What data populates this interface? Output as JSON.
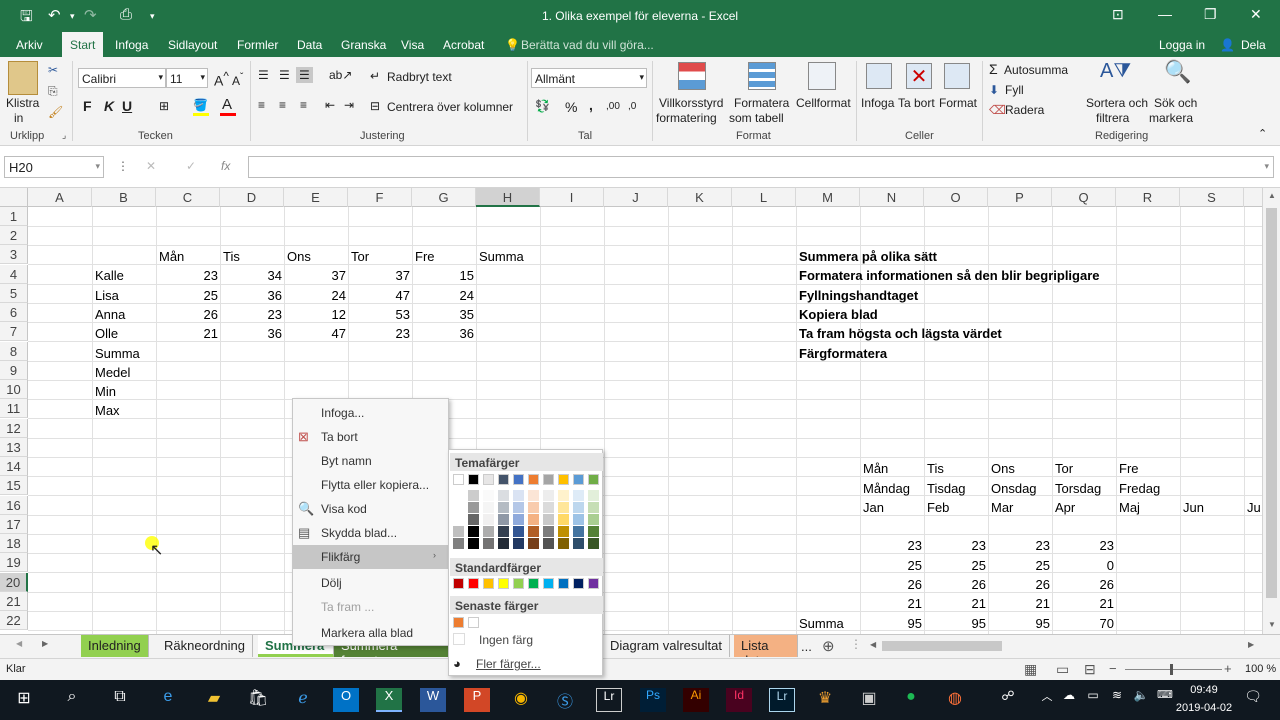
{
  "window": {
    "title": "1. Olika exempel för eleverna  -  Excel"
  },
  "ribbon_tabs": [
    "Arkiv",
    "Start",
    "Infoga",
    "Sidlayout",
    "Formler",
    "Data",
    "Granska",
    "Visa",
    "Acrobat"
  ],
  "tell_me": "Berätta vad du vill göra...",
  "account": {
    "login": "Logga in",
    "share": "Dela"
  },
  "clipboard": {
    "paste": "Klistra",
    "paste2": "in",
    "label": "Urklipp"
  },
  "font": {
    "name": "Calibri",
    "size": "11",
    "label": "Tecken",
    "bold": "F",
    "italic": "K",
    "underline": "U"
  },
  "alignment": {
    "wrap": "Radbryt text",
    "merge": "Centrera över kolumner",
    "label": "Justering"
  },
  "number": {
    "format": "Allmänt",
    "percent": "%",
    "comma": ",",
    "label": "Tal"
  },
  "styles": {
    "cond1": "Villkorsstyrd",
    "cond2": "formatering",
    "table1": "Formatera",
    "table2": "som tabell",
    "cell": "Cellformat",
    "label": "Format"
  },
  "cells": {
    "insert": "Infoga",
    "delete": "Ta bort",
    "format": "Format",
    "label": "Celler"
  },
  "editing": {
    "autosum": "Autosumma",
    "fill": "Fyll",
    "clear": "Radera",
    "sort1": "Sortera och",
    "sort2": "filtrera",
    "find1": "Sök och",
    "find2": "markera",
    "label": "Redigering"
  },
  "formula_bar": {
    "namebox": "H20",
    "fx": "fx",
    "x": "✕",
    "check": "✓"
  },
  "columns": [
    "A",
    "B",
    "C",
    "D",
    "E",
    "F",
    "G",
    "H",
    "I",
    "J",
    "K",
    "L",
    "M",
    "N",
    "O",
    "P",
    "Q",
    "R",
    "S"
  ],
  "rows": [
    "1",
    "2",
    "3",
    "4",
    "5",
    "6",
    "7",
    "8",
    "9",
    "10",
    "11",
    "12",
    "13",
    "14",
    "15",
    "16",
    "17",
    "18",
    "19",
    "20",
    "21",
    "22"
  ],
  "table1": {
    "headers": [
      "Mån",
      "Tis",
      "Ons",
      "Tor",
      "Fre",
      "Summa"
    ],
    "rows": [
      {
        "name": "Kalle",
        "v": [
          "23",
          "34",
          "37",
          "37",
          "15"
        ]
      },
      {
        "name": "Lisa",
        "v": [
          "25",
          "36",
          "24",
          "47",
          "24"
        ]
      },
      {
        "name": "Anna",
        "v": [
          "26",
          "23",
          "12",
          "53",
          "35"
        ]
      },
      {
        "name": "Olle",
        "v": [
          "21",
          "36",
          "47",
          "23",
          "36"
        ]
      }
    ],
    "stats": [
      "Summa",
      "Medel",
      "Min",
      "Max"
    ]
  },
  "tasks": [
    "Summera på olika sätt",
    "Formatera informationen så den blir begripligare",
    "Fyllningshandtaget",
    "Kopiera blad",
    "Ta fram högsta och lägsta värdet",
    "Färgformatera"
  ],
  "table2": {
    "row14": [
      "Mån",
      "Tis",
      "Ons",
      "Tor",
      "Fre"
    ],
    "row15": [
      "Måndag",
      "Tisdag",
      "Onsdag",
      "Torsdag",
      "Fredag"
    ],
    "row16": [
      "Jan",
      "Feb",
      "Mar",
      "Apr",
      "Maj",
      "Jun",
      "Ju"
    ],
    "data": [
      [
        "23",
        "23",
        "23",
        "23"
      ],
      [
        "25",
        "25",
        "25",
        "0"
      ],
      [
        "26",
        "26",
        "26",
        "26"
      ],
      [
        "21",
        "21",
        "21",
        "21"
      ],
      [
        "95",
        "95",
        "95",
        "70"
      ]
    ],
    "sum_label": "Summa"
  },
  "context_menu": [
    "Infoga...",
    "Ta bort",
    "Byt namn",
    "Flytta eller kopiera...",
    "Visa kod",
    "Skydda blad...",
    "Flikfärg",
    "Dölj",
    "Ta fram ...",
    "Markera alla blad"
  ],
  "palette": {
    "theme_label": "Temafärger",
    "theme_top": [
      "#ffffff",
      "#000000",
      "#e7e6e6",
      "#44546a",
      "#4472c4",
      "#ed7d31",
      "#a5a5a5",
      "#ffc000",
      "#5b9bd5",
      "#70ad47"
    ],
    "standard_label": "Standardfärger",
    "standard": [
      "#c00000",
      "#ff0000",
      "#ffc000",
      "#ffff00",
      "#92d050",
      "#00b050",
      "#00b0f0",
      "#0070c0",
      "#002060",
      "#7030a0"
    ],
    "recent_label": "Senaste färger",
    "recent": [
      "#ed7d31",
      "#ffffff"
    ],
    "no_color": "Ingen färg",
    "more": "Fler färger..."
  },
  "sheet_tabs": [
    {
      "label": "Inledning",
      "color": "#92d050"
    },
    {
      "label": "Räkneordning",
      "color": ""
    },
    {
      "label": "Summera",
      "color": "#92d050"
    },
    {
      "label": "Summera formate",
      "color": "#548235"
    },
    {
      "label": "Diagram valresultat",
      "color": ""
    },
    {
      "label": "Lista data",
      "color": "#f4b183"
    }
  ],
  "more_tabs": "...",
  "status": {
    "ready": "Klar",
    "zoom": "100 %"
  },
  "taskbar": {
    "time": "09:49",
    "date": "2019-04-02"
  }
}
